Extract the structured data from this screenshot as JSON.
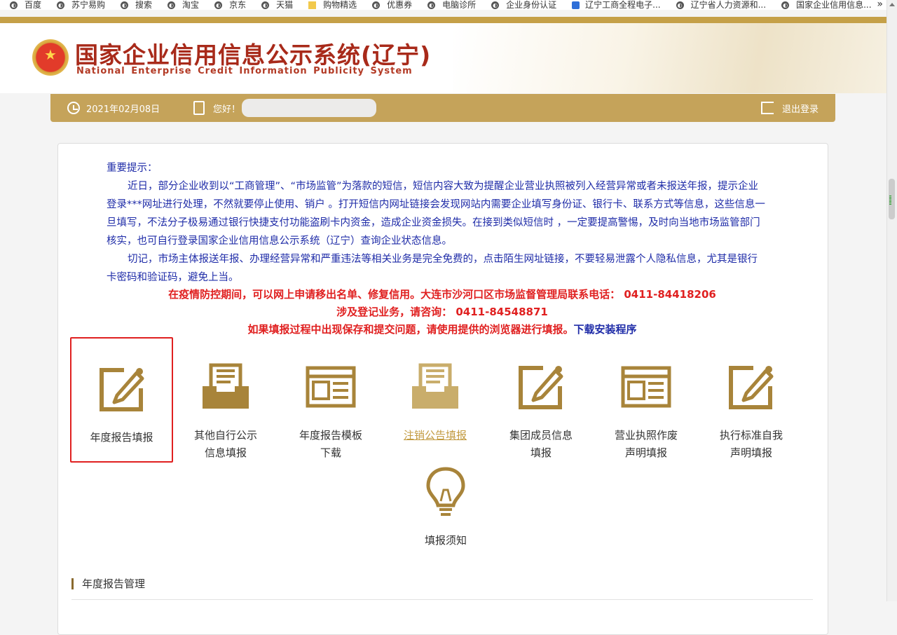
{
  "bookmarks": [
    {
      "label": "百度",
      "icon": "globe-icon"
    },
    {
      "label": "苏宁易购",
      "icon": "globe-icon"
    },
    {
      "label": "搜索",
      "icon": "globe-icon"
    },
    {
      "label": "淘宝",
      "icon": "globe-icon"
    },
    {
      "label": "京东",
      "icon": "globe-icon"
    },
    {
      "label": "天猫",
      "icon": "globe-icon"
    },
    {
      "label": "购物精选",
      "icon": "folder-icon"
    },
    {
      "label": "优惠券",
      "icon": "globe-icon"
    },
    {
      "label": "电脑诊所",
      "icon": "globe-icon"
    },
    {
      "label": "企业身份认证",
      "icon": "globe-icon"
    },
    {
      "label": "辽宁工商全程电子...",
      "icon": "shield-icon"
    },
    {
      "label": "辽宁省人力资源和...",
      "icon": "globe-icon"
    },
    {
      "label": "国家企业信用信息...",
      "icon": "globe-icon"
    }
  ],
  "bookmarks_more": "»",
  "header": {
    "title_cn": "国家企业信用信息公示系统(辽宁)",
    "title_en": "National Enterprise Credit Information Publicity System"
  },
  "userbar": {
    "date": "2021年02月08日",
    "greeting": "您好！",
    "logout": "退出登录"
  },
  "notice": {
    "heading": "重要提示：",
    "para1": "近日，部分企业收到以“工商管理”、“市场监管”为落款的短信，短信内容大致为提醒企业营业执照被列入经营异常或者未报送年报，提示企业登录***网址进行处理，不然就要停止使用、销户 。打开短信内网址链接会发现网站内需要企业填写身份证、银行卡、联系方式等信息，这些信息一旦填写，不法分子极易通过银行快捷支付功能盗刷卡内资金，造成企业资金损失。在接到类似短信时 ，一定要提高警惕，及时向当地市场监管部门核实，也可自行登录国家企业信用信息公示系统（辽宁）查询企业状态信息。",
    "para2": "切记，市场主体报送年报、办理经营异常和严重违法等相关业务是完全免费的，点击陌生网址链接，不要轻易泄露个人隐私信息，尤其是银行卡密码和验证码，避免上当。",
    "red1": "在疫情防控期间，可以网上申请移出名单、修复信用。大连市沙河口区市场监督管理局联系电话： 0411-84418206",
    "red2": "涉及登记业务，请咨询： 0411-84548871",
    "red3": "如果填报过程中出现保存和提交问题，请使用提供的浏览器进行填报。",
    "download_link": "下载安装程序"
  },
  "tiles": [
    {
      "line1": "年度报告填报",
      "line2": "",
      "icon": "edit-pencil-icon"
    },
    {
      "line1": "其他自行公示",
      "line2": "信息填报",
      "icon": "tray-document-icon"
    },
    {
      "line1": "年度报告模板",
      "line2": "下载",
      "icon": "form-template-icon"
    },
    {
      "line1": "注销公告填报",
      "line2": "",
      "icon": "tray-document-icon"
    },
    {
      "line1": "集团成员信息",
      "line2": "填报",
      "icon": "edit-pencil-icon"
    },
    {
      "line1": "营业执照作废",
      "line2": "声明填报",
      "icon": "form-template-icon"
    },
    {
      "line1": "执行标准自我",
      "line2": "声明填报",
      "icon": "edit-pencil-icon"
    },
    {
      "line1": "填报须知",
      "line2": "",
      "icon": "lightbulb-icon"
    }
  ],
  "section": {
    "title": "年度报告管理"
  },
  "colors": {
    "gold": "#c5a35a",
    "icon_gold": "#a8843a",
    "notice_blue": "#1f2ca8",
    "alert_red": "#e02020",
    "title_red": "#a82a1a"
  }
}
